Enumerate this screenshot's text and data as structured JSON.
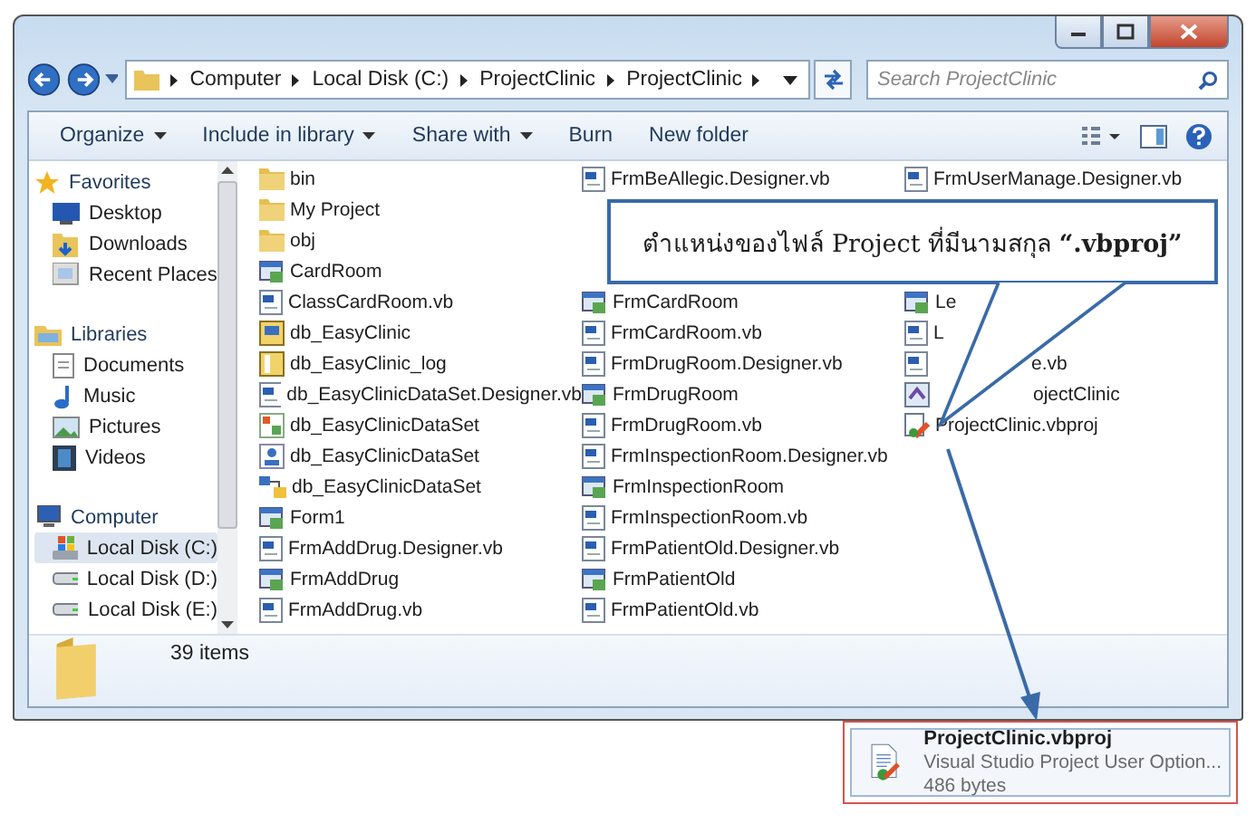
{
  "address": {
    "path": [
      "Computer",
      "Local Disk (C:)",
      "ProjectClinic",
      "ProjectClinic"
    ]
  },
  "search": {
    "placeholder": "Search ProjectClinic"
  },
  "toolbar": [
    {
      "label": "Organize",
      "dropdown": true
    },
    {
      "label": "Include in library",
      "dropdown": true
    },
    {
      "label": "Share with",
      "dropdown": true
    },
    {
      "label": "Burn",
      "dropdown": false
    },
    {
      "label": "New folder",
      "dropdown": false
    }
  ],
  "sidebar": {
    "groups": [
      {
        "label": "Favorites",
        "kind": "star",
        "items": [
          {
            "label": "Desktop",
            "kind": "desktop",
            "selected": false
          },
          {
            "label": "Downloads",
            "kind": "downloads",
            "selected": false
          },
          {
            "label": "Recent Places",
            "kind": "recent",
            "selected": false
          }
        ]
      },
      {
        "label": "Libraries",
        "kind": "library",
        "items": [
          {
            "label": "Documents",
            "kind": "documents",
            "selected": false
          },
          {
            "label": "Music",
            "kind": "music",
            "selected": false
          },
          {
            "label": "Pictures",
            "kind": "pictures",
            "selected": false
          },
          {
            "label": "Videos",
            "kind": "videos",
            "selected": false
          }
        ]
      },
      {
        "label": "Computer",
        "kind": "computer",
        "items": [
          {
            "label": "Local Disk (C:)",
            "kind": "windisk",
            "selected": true
          },
          {
            "label": "Local Disk (D:)",
            "kind": "disk",
            "selected": false
          },
          {
            "label": "Local Disk (E:)",
            "kind": "disk",
            "selected": false
          }
        ]
      }
    ]
  },
  "files": {
    "columns": [
      {
        "items": [
          {
            "name": "bin",
            "kind": "folder"
          },
          {
            "name": "My Project",
            "kind": "folder"
          },
          {
            "name": "obj",
            "kind": "folder"
          },
          {
            "name": "CardRoom",
            "kind": "form"
          },
          {
            "name": "ClassCardRoom.vb",
            "kind": "vb"
          },
          {
            "name": "db_EasyClinic",
            "kind": "db"
          },
          {
            "name": "db_EasyClinic_log",
            "kind": "log"
          },
          {
            "name": "db_EasyClinicDataSet.Designer.vb",
            "kind": "vb"
          },
          {
            "name": "db_EasyClinicDataSet",
            "kind": "xsd"
          },
          {
            "name": "db_EasyClinicDataSet",
            "kind": "xsc"
          },
          {
            "name": "db_EasyClinicDataSet",
            "kind": "xss"
          },
          {
            "name": "Form1",
            "kind": "form"
          },
          {
            "name": "FrmAddDrug.Designer.vb",
            "kind": "vb"
          },
          {
            "name": "FrmAddDrug",
            "kind": "form"
          },
          {
            "name": "FrmAddDrug.vb",
            "kind": "vb"
          }
        ]
      },
      {
        "items": [
          {
            "name": "FrmBeAllegic.Designer.vb",
            "kind": "vb"
          }
        ],
        "items_after_note": [
          {
            "name": "FrmCardRoom",
            "kind": "form"
          },
          {
            "name": "FrmCardRoom.vb",
            "kind": "vb"
          },
          {
            "name": "FrmDrugRoom.Designer.vb",
            "kind": "vb"
          },
          {
            "name": "FrmDrugRoom",
            "kind": "form"
          },
          {
            "name": "FrmDrugRoom.vb",
            "kind": "vb"
          },
          {
            "name": "FrmInspectionRoom.Designer.vb",
            "kind": "vb"
          },
          {
            "name": "FrmInspectionRoom",
            "kind": "form"
          },
          {
            "name": "FrmInspectionRoom.vb",
            "kind": "vb"
          },
          {
            "name": "FrmPatientOld.Designer.vb",
            "kind": "vb"
          },
          {
            "name": "FrmPatientOld",
            "kind": "form"
          },
          {
            "name": "FrmPatientOld.vb",
            "kind": "vb"
          }
        ]
      },
      {
        "items": [
          {
            "name": "FrmUserManage.Designer.vb",
            "kind": "vb"
          }
        ],
        "items_after_note": [
          {
            "name": "Le",
            "kind": "form",
            "covered_prefix": false
          },
          {
            "name": "L",
            "kind": "vb",
            "covered_prefix": false
          },
          {
            "name": "e.vb",
            "kind": "vb",
            "covered_prefix": true
          },
          {
            "name": "ojectClinic",
            "kind": "project",
            "covered_prefix": true
          },
          {
            "name": "ProjectClinic.vbproj",
            "kind": "vbproj",
            "covered_prefix": false
          }
        ]
      }
    ]
  },
  "status": {
    "count": "39 items"
  },
  "note": {
    "text": "ตำแหน่งของไฟล์ Project ที่มีนามสกุล **“.vbproj”**"
  },
  "preview": {
    "name": "ProjectClinic.vbproj",
    "type": "Visual Studio Project User Option...",
    "size": "486 bytes"
  }
}
